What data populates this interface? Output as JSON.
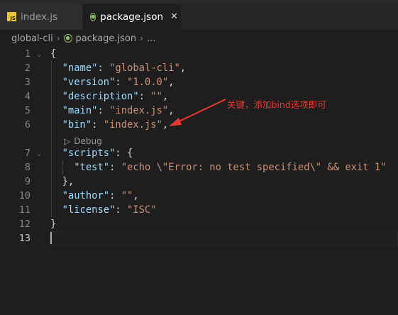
{
  "tabs": [
    {
      "label": "index.js",
      "icon": "js-file-icon",
      "active": false
    },
    {
      "label": "package.json",
      "icon": "nodejs-file-icon",
      "active": true
    }
  ],
  "breadcrumb": {
    "folder": "global-cli",
    "file": "package.json",
    "more": "..."
  },
  "line_numbers": [
    "1",
    "2",
    "3",
    "4",
    "5",
    "6",
    "7",
    "8",
    "9",
    "10",
    "11",
    "12",
    "13"
  ],
  "code": {
    "l1_open": "{",
    "l2_key": "\"name\"",
    "l2_val": "\"global-cli\"",
    "l3_key": "\"version\"",
    "l3_val": "\"1.0.0\"",
    "l4_key": "\"description\"",
    "l4_val": "\"\"",
    "l5_key": "\"main\"",
    "l5_val": "\"index.js\"",
    "l6_key": "\"bin\"",
    "l6_val": "\"index.js\"",
    "l7_key": "\"scripts\"",
    "l7_open": "{",
    "l8_key": "\"test\"",
    "l8_val": "\"echo \\\"Error: no test specified\\\" && exit 1\"",
    "l9_close": "},",
    "l10_key": "\"author\"",
    "l10_val": "\"\"",
    "l11_key": "\"license\"",
    "l11_val": "\"ISC\"",
    "l12_close": "}",
    "colon": ": ",
    "comma": ","
  },
  "codelens": {
    "label": "Debug",
    "icon": "play-outline-icon"
  },
  "annotation": {
    "text": "关键，添加bind选项即可",
    "color": "#e8382d"
  },
  "colors": {
    "key": "#9cdcfe",
    "string": "#ce9178",
    "background": "#1e1e1e"
  }
}
